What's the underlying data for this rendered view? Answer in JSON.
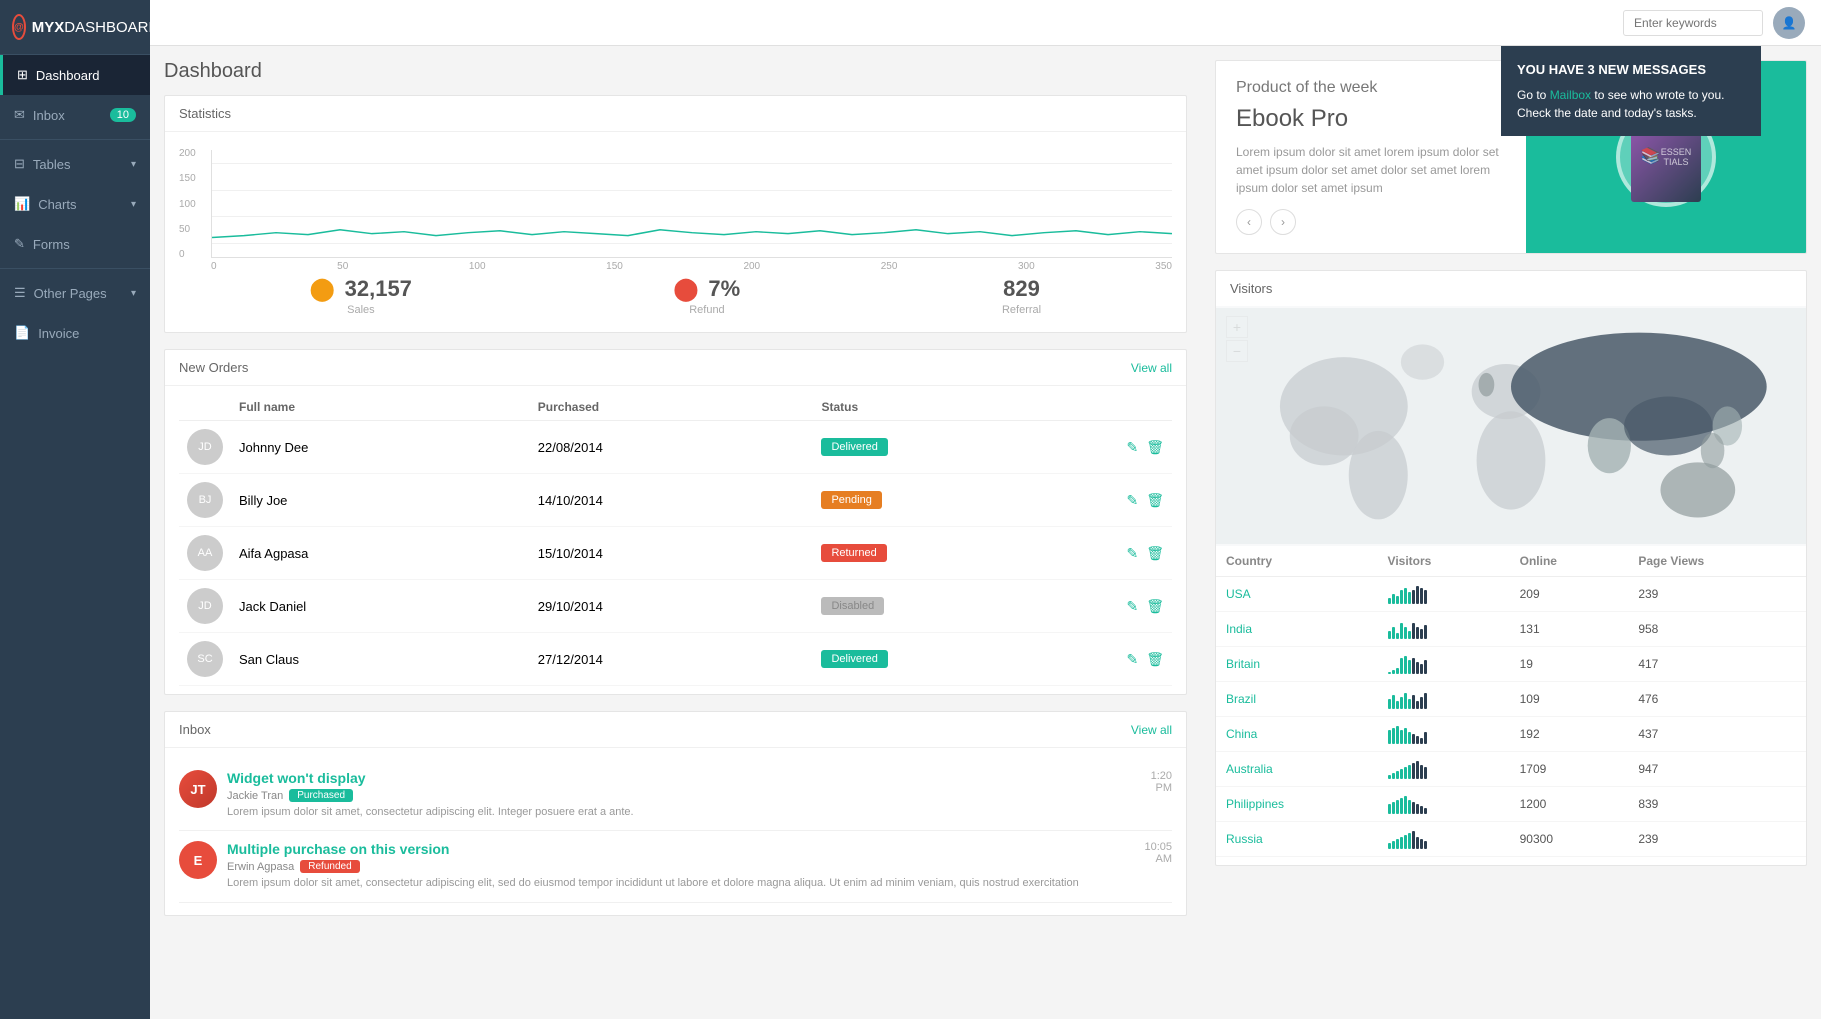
{
  "app": {
    "name": "MYX",
    "name2": "DASHBOARD"
  },
  "sidebar": {
    "items": [
      {
        "id": "dashboard",
        "label": "Dashboard",
        "icon": "grid",
        "active": true
      },
      {
        "id": "inbox",
        "label": "Inbox",
        "icon": "envelope",
        "badge": "10"
      },
      {
        "id": "tables",
        "label": "Tables",
        "icon": "table",
        "arrow": "▾"
      },
      {
        "id": "charts",
        "label": "Charts",
        "icon": "chart",
        "arrow": "▾"
      },
      {
        "id": "forms",
        "label": "Forms",
        "icon": "form"
      },
      {
        "id": "other-pages",
        "label": "Other Pages",
        "icon": "page",
        "arrow": "▾"
      },
      {
        "id": "invoice",
        "label": "Invoice",
        "icon": "doc"
      }
    ]
  },
  "topbar": {
    "search_placeholder": "Enter keywords",
    "notification": {
      "title": "YOU HAVE 3 NEW MESSAGES",
      "text1": "Go to ",
      "link_text": "Mailbox",
      "text2": " to see who wrote to you. Check the date and today's tasks."
    }
  },
  "page_title": "Dashboard",
  "statistics": {
    "title": "Statistics",
    "y_labels": [
      "200",
      "150",
      "100",
      "50",
      "0"
    ],
    "x_labels": [
      "0",
      "50",
      "100",
      "150",
      "200",
      "250",
      "300",
      "350"
    ],
    "stats": [
      {
        "icon": "up",
        "value": "32,157",
        "label": "Sales"
      },
      {
        "icon": "down",
        "value": "7%",
        "label": "Refund"
      },
      {
        "value": "829",
        "label": "Referral"
      }
    ]
  },
  "new_orders": {
    "title": "New Orders",
    "view_all": "View all",
    "columns": [
      "Full name",
      "Purchased",
      "Status"
    ],
    "rows": [
      {
        "name": "Johnny Dee",
        "date": "22/08/2014",
        "status": "Delivered",
        "status_class": "status-delivered",
        "avatar_class": "av1",
        "initials": "JD"
      },
      {
        "name": "Billy Joe",
        "date": "14/10/2014",
        "status": "Pending",
        "status_class": "status-pending",
        "avatar_class": "av2",
        "initials": "BJ"
      },
      {
        "name": "Aifa Agpasa",
        "date": "15/10/2014",
        "status": "Returned",
        "status_class": "status-returned",
        "avatar_class": "av3",
        "initials": "AA"
      },
      {
        "name": "Jack Daniel",
        "date": "29/10/2014",
        "status": "Disabled",
        "status_class": "status-disabled",
        "avatar_class": "av4",
        "initials": "JD"
      },
      {
        "name": "San Claus",
        "date": "27/12/2014",
        "status": "Delivered",
        "status_class": "status-delivered",
        "avatar_class": "av5",
        "initials": "SC"
      }
    ]
  },
  "inbox": {
    "title": "Inbox",
    "view_all": "View all",
    "messages": [
      {
        "subject": "Widget won't display",
        "sender": "Jackie Tran",
        "tag": "Purchased",
        "tag_class": "tag-purchased",
        "preview": "Lorem ipsum dolor sit amet, consectetur adipiscing elit. Integer posuere erat a ante.",
        "time": "1:20",
        "time_unit": "PM",
        "avatar_type": "img",
        "avatar_class": "av1",
        "initials": "JT"
      },
      {
        "subject": "Multiple purchase on this version",
        "sender": "Erwin Agpasa",
        "tag": "Refunded",
        "tag_class": "tag-refunded",
        "preview": "Lorem ipsum dolor sit amet, consectetur adipiscing elit, sed do eiusmod tempor incididunt ut labore et dolore magna aliqua. Ut enim ad minim veniam, quis nostrud exercitation",
        "time": "10:05",
        "time_unit": "AM",
        "avatar_type": "letter",
        "avatar_class": "av-e",
        "initials": "E"
      }
    ]
  },
  "product": {
    "week_label": "Product of the week",
    "name": "Ebook Pro",
    "description": "Lorem ipsum dolor sit amet lorem ipsum dolor set amet ipsum dolor set amet dolor set amet lorem ipsum dolor set amet ipsum",
    "book_label": "ESSEN\nTIALS"
  },
  "visitors": {
    "title": "Visitors",
    "columns": [
      "Country",
      "Visitors",
      "Online",
      "Page Views"
    ],
    "rows": [
      {
        "country": "USA",
        "online": "209",
        "page_views": "239",
        "bars": [
          3,
          5,
          4,
          7,
          8,
          6,
          7,
          9,
          8,
          7
        ]
      },
      {
        "country": "India",
        "online": "131",
        "page_views": "958",
        "bars": [
          4,
          6,
          3,
          8,
          6,
          4,
          8,
          6,
          5,
          7
        ]
      },
      {
        "country": "Britain",
        "online": "19",
        "page_views": "417",
        "bars": [
          1,
          2,
          3,
          8,
          9,
          7,
          8,
          6,
          5,
          7
        ]
      },
      {
        "country": "Brazil",
        "online": "109",
        "page_views": "476",
        "bars": [
          5,
          7,
          4,
          6,
          8,
          5,
          7,
          4,
          6,
          8
        ]
      },
      {
        "country": "China",
        "online": "192",
        "page_views": "437",
        "bars": [
          7,
          8,
          9,
          7,
          8,
          6,
          5,
          4,
          3,
          6
        ]
      },
      {
        "country": "Australia",
        "online": "1709",
        "page_views": "947",
        "bars": [
          2,
          3,
          4,
          5,
          6,
          7,
          8,
          9,
          7,
          6
        ]
      },
      {
        "country": "Philippines",
        "online": "1200",
        "page_views": "839",
        "bars": [
          5,
          6,
          7,
          8,
          9,
          7,
          6,
          5,
          4,
          3
        ]
      },
      {
        "country": "Russia",
        "online": "90300",
        "page_views": "239",
        "bars": [
          3,
          4,
          5,
          6,
          7,
          8,
          9,
          6,
          5,
          4
        ]
      }
    ]
  }
}
